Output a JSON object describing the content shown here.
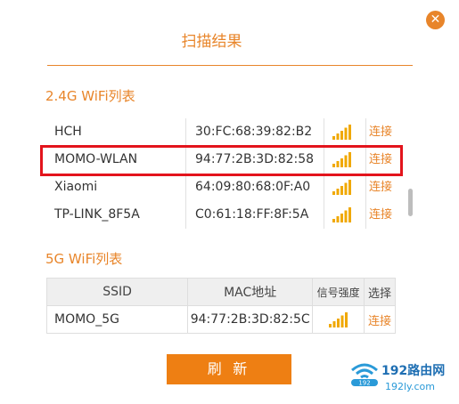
{
  "dialog": {
    "title": "扫描结果",
    "close_icon": "close-icon",
    "refresh_label": "刷 新"
  },
  "wifi24": {
    "label": "2.4G WiFi列表",
    "rows": [
      {
        "ssid": "HCH",
        "mac": "30:FC:68:39:82:B2",
        "action": "连接"
      },
      {
        "ssid": "MOMO-WLAN",
        "mac": "94:77:2B:3D:82:58",
        "action": "连接"
      },
      {
        "ssid": "Xiaomi",
        "mac": "64:09:80:68:0F:A0",
        "action": "连接"
      },
      {
        "ssid": "TP-LINK_8F5A",
        "mac": "C0:61:18:FF:8F:5A",
        "action": "连接"
      }
    ]
  },
  "wifi5": {
    "label": "5G WiFi列表",
    "headers": {
      "ssid": "SSID",
      "mac": "MAC地址",
      "signal": "信号强度",
      "action": "选择"
    },
    "rows": [
      {
        "ssid": "MOMO_5G",
        "mac": "94:77:2B:3D:82:5C",
        "action": "连接"
      }
    ]
  },
  "watermark": {
    "brand": "192路由网",
    "url": "192ly.com",
    "prefix": "192"
  },
  "colors": {
    "accent": "#e8852a",
    "button": "#ee7f13",
    "highlight": "#e3141c"
  }
}
